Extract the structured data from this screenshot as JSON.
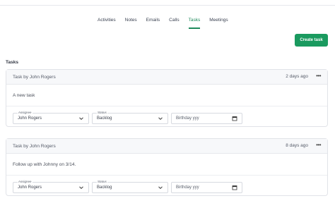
{
  "tabs": [
    {
      "label": "Activities"
    },
    {
      "label": "Notes"
    },
    {
      "label": "Emails"
    },
    {
      "label": "Calls"
    },
    {
      "label": "Tasks",
      "active": true
    },
    {
      "label": "Meetings"
    }
  ],
  "create_task_label": "Create task",
  "section_title": "Tasks",
  "tasks": [
    {
      "title": "Task by John Rogers",
      "time": "2 days ago",
      "more": "•••",
      "description": "A new task",
      "assignee_label": "Assignee",
      "assignee": "John Rogers",
      "status_label": "Status",
      "status": "Backlog",
      "date_placeholder": "Birthday  yyy"
    },
    {
      "title": "Task by John Rogers",
      "time": "8 days ago",
      "more": "•••",
      "description": "Follow up with Johnny on 3/14.",
      "assignee_label": "Assignee",
      "assignee": "John Rogers",
      "status_label": "Status",
      "status": "Backlog",
      "date_placeholder": "Birthday  yyy"
    }
  ],
  "colors": {
    "accent": "#1a9a5f",
    "active_tab": "#1f8a5c"
  }
}
